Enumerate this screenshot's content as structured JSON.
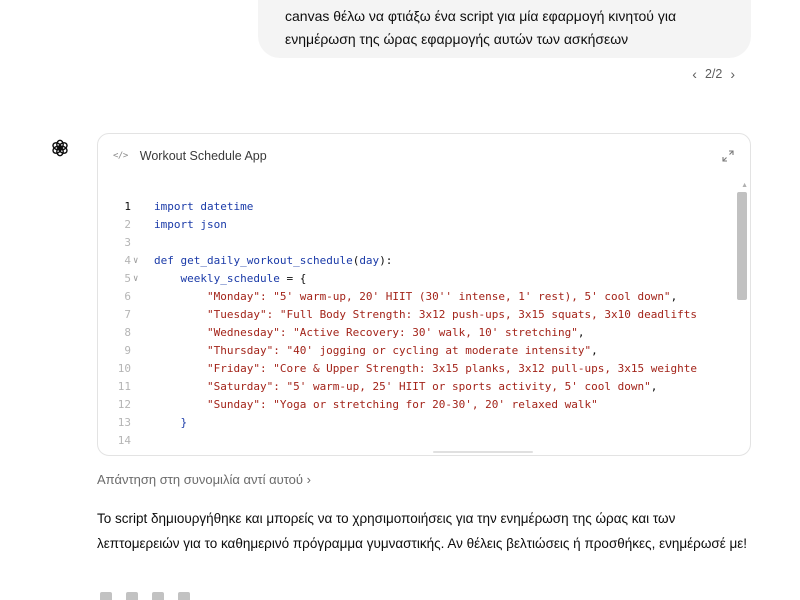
{
  "user_message": {
    "text": "canvas θέλω να φτιάξω ένα script για μία εφαρμογή κινητού για ενημέρωση της ώρας εφαρμογής αυτών των ασκήσεων"
  },
  "pager": {
    "prev": "‹",
    "label": "2/2",
    "next": "›"
  },
  "canvas": {
    "title": "Workout Schedule App",
    "code_icon": "</>",
    "expand_icon": "expand-icon",
    "lines": [
      {
        "n": "1",
        "fold": "",
        "tokens": [
          {
            "t": "import ",
            "c": "kw"
          },
          {
            "t": "datetime",
            "c": "kw"
          }
        ]
      },
      {
        "n": "2",
        "fold": "",
        "tokens": [
          {
            "t": "import ",
            "c": "kw"
          },
          {
            "t": "json",
            "c": "kw"
          }
        ]
      },
      {
        "n": "3",
        "fold": "",
        "tokens": []
      },
      {
        "n": "4",
        "fold": "∨",
        "tokens": [
          {
            "t": "def ",
            "c": "def"
          },
          {
            "t": "get_daily_workout_schedule",
            "c": "fn"
          },
          {
            "t": "(",
            "c": "plain"
          },
          {
            "t": "day",
            "c": "var"
          },
          {
            "t": "):",
            "c": "plain"
          }
        ]
      },
      {
        "n": "5",
        "fold": "∨",
        "tokens": [
          {
            "t": "    weekly_schedule",
            "c": "var"
          },
          {
            "t": " = {",
            "c": "plain"
          }
        ]
      },
      {
        "n": "6",
        "fold": "",
        "tokens": [
          {
            "t": "        \"Monday\": \"5' warm-up, 20' HIIT (30'' intense, 1' rest), 5' cool down\"",
            "c": "str"
          },
          {
            "t": ",",
            "c": "plain"
          }
        ]
      },
      {
        "n": "7",
        "fold": "",
        "tokens": [
          {
            "t": "        \"Tuesday\": \"Full Body Strength: 3x12 push-ups, 3x15 squats, 3x10 deadlifts",
            "c": "str"
          }
        ]
      },
      {
        "n": "8",
        "fold": "",
        "tokens": [
          {
            "t": "        \"Wednesday\": \"Active Recovery: 30' walk, 10' stretching\"",
            "c": "str"
          },
          {
            "t": ",",
            "c": "plain"
          }
        ]
      },
      {
        "n": "9",
        "fold": "",
        "tokens": [
          {
            "t": "        \"Thursday\": \"40' jogging or cycling at moderate intensity\"",
            "c": "str"
          },
          {
            "t": ",",
            "c": "plain"
          }
        ]
      },
      {
        "n": "10",
        "fold": "",
        "tokens": [
          {
            "t": "        \"Friday\": \"Core & Upper Strength: 3x15 planks, 3x12 pull-ups, 3x15 weighte",
            "c": "str"
          }
        ]
      },
      {
        "n": "11",
        "fold": "",
        "tokens": [
          {
            "t": "        \"Saturday\": \"5' warm-up, 25' HIIT or sports activity, 5' cool down\"",
            "c": "str"
          },
          {
            "t": ",",
            "c": "plain"
          }
        ]
      },
      {
        "n": "12",
        "fold": "",
        "tokens": [
          {
            "t": "        \"Sunday\": \"Yoga or stretching for 20-30', 20' relaxed walk\"",
            "c": "str"
          }
        ]
      },
      {
        "n": "13",
        "fold": "",
        "tokens": [
          {
            "t": "    }",
            "c": "var"
          }
        ]
      },
      {
        "n": "14",
        "fold": "",
        "tokens": []
      }
    ]
  },
  "reply_link": "Απάντηση στη συνομιλία αντί αυτού ›",
  "assistant_message": {
    "text": "Το script δημιουργήθηκε και μπορείς να το χρησιμοποιήσεις για την ενημέρωση της ώρας και των λεπτομερειών για το καθημερινό πρόγραμμα γυμναστικής. Αν θέλεις βελτιώσεις ή προσθήκες, ενημέρωσέ με!"
  },
  "icons": {
    "assistant_logo": "chatgpt-logo-icon",
    "actions": [
      "copy-icon",
      "thumbs-up-icon",
      "thumbs-down-icon",
      "regenerate-icon"
    ]
  }
}
